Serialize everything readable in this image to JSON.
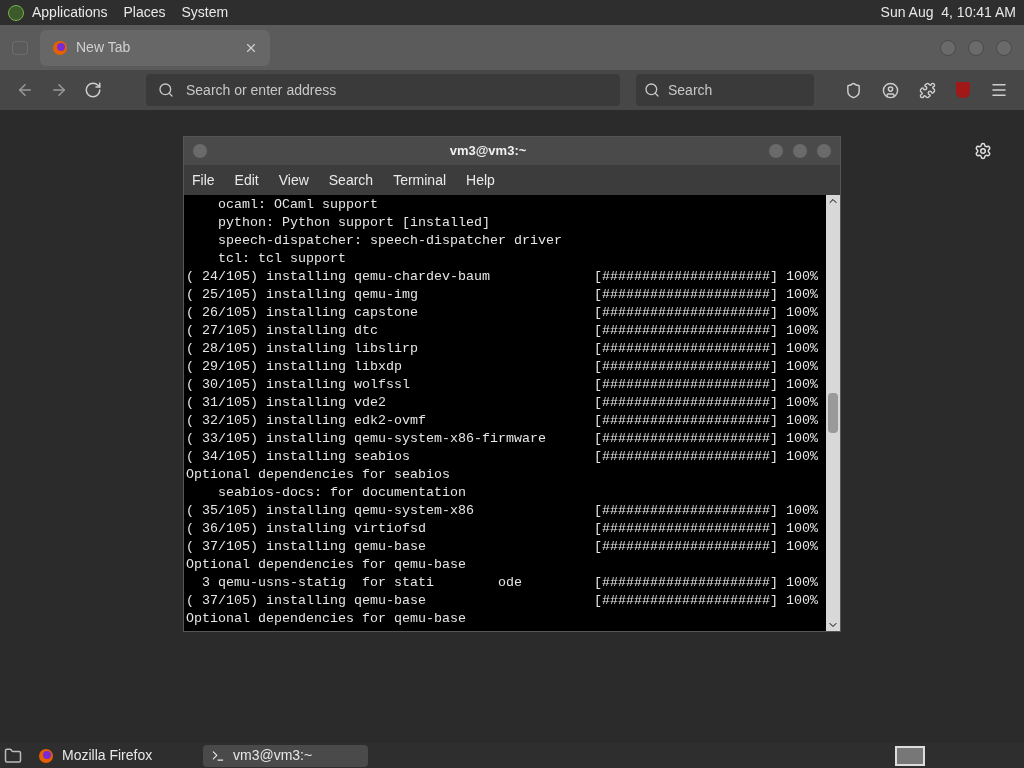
{
  "top_panel": {
    "menus": [
      "Applications",
      "Places",
      "System"
    ],
    "clock": "Sun Aug  4, 10:41 AM"
  },
  "browser": {
    "tabs": [
      {
        "label": "New Tab",
        "selected": true
      }
    ],
    "address": {
      "placeholder": "Search or enter address"
    },
    "search": {
      "placeholder": "Search"
    }
  },
  "terminal": {
    "title": "vm3@vm3:~",
    "menu": [
      "File",
      "Edit",
      "View",
      "Search",
      "Terminal",
      "Help"
    ],
    "lines": [
      {
        "text": "    ocaml: OCaml support"
      },
      {
        "text": "    python: Python support [installed]"
      },
      {
        "text": "    speech-dispatcher: speech-dispatcher driver"
      },
      {
        "text": "    tcl: tcl support"
      },
      {
        "text": "( 24/105) installing qemu-chardev-baum",
        "bar": "[#####################]",
        "percent": "100%"
      },
      {
        "text": "( 25/105) installing qemu-img",
        "bar": "[#####################]",
        "percent": "100%"
      },
      {
        "text": "( 26/105) installing capstone",
        "bar": "[#####################]",
        "percent": "100%"
      },
      {
        "text": "( 27/105) installing dtc",
        "bar": "[#####################]",
        "percent": "100%"
      },
      {
        "text": "( 28/105) installing libslirp",
        "bar": "[#####################]",
        "percent": "100%"
      },
      {
        "text": "( 29/105) installing libxdp",
        "bar": "[#####################]",
        "percent": "100%"
      },
      {
        "text": "( 30/105) installing wolfssl",
        "bar": "[#####################]",
        "percent": "100%"
      },
      {
        "text": "( 31/105) installing vde2",
        "bar": "[#####################]",
        "percent": "100%"
      },
      {
        "text": "( 32/105) installing edk2-ovmf",
        "bar": "[#####################]",
        "percent": "100%"
      },
      {
        "text": "( 33/105) installing qemu-system-x86-firmware",
        "bar": "[#####################]",
        "percent": "100%"
      },
      {
        "text": "( 34/105) installing seabios",
        "bar": "[#####################]",
        "percent": "100%"
      },
      {
        "text": "Optional dependencies for seabios"
      },
      {
        "text": "    seabios-docs: for documentation"
      },
      {
        "text": "( 35/105) installing qemu-system-x86",
        "bar": "[#####################]",
        "percent": "100%"
      },
      {
        "text": "( 36/105) installing virtiofsd",
        "bar": "[#####################]",
        "percent": "100%"
      },
      {
        "text": "( 37/105) installing qemu-base",
        "bar": "[#####################]",
        "percent": "100%"
      },
      {
        "text": "Optional dependencies for qemu-base"
      },
      {
        "text": "  3 qemu-usns-statig  for stati        ode",
        "bar": "[#####################]",
        "percent": "100%"
      },
      {
        "text": "( 37/105) installing qemu-base",
        "bar": "[#####################]",
        "percent": "100%"
      },
      {
        "text": "Optional dependencies for qemu-base"
      }
    ]
  },
  "taskbar": {
    "items": [
      {
        "label": "Mozilla Firefox",
        "kind": "browser",
        "selected": false
      },
      {
        "label": "vm3@vm3:~",
        "kind": "terminal",
        "selected": true
      }
    ]
  }
}
